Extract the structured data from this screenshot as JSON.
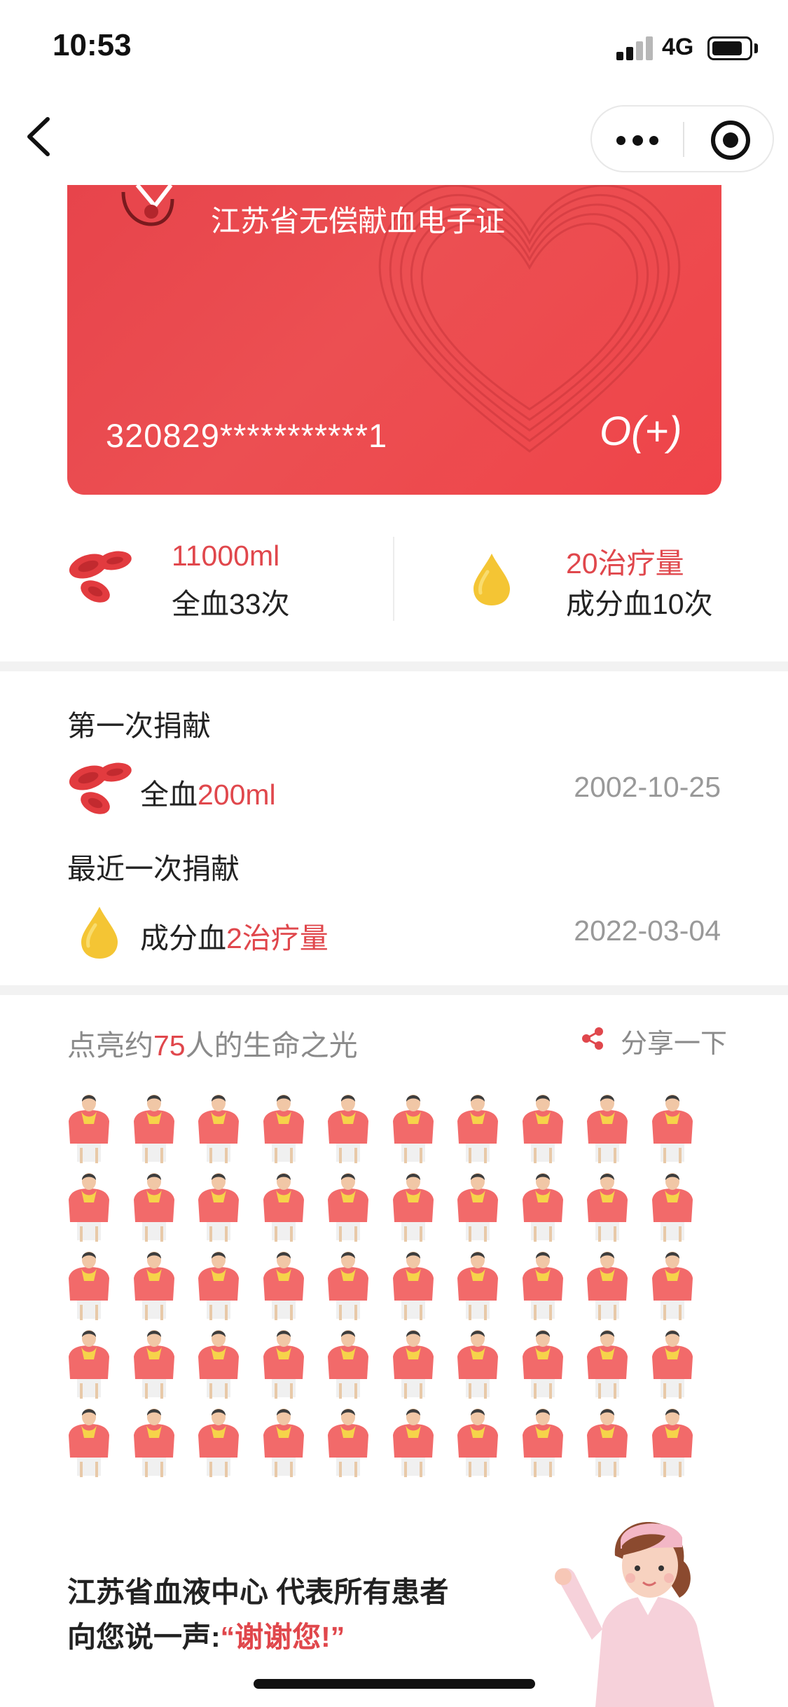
{
  "status_bar": {
    "time": "10:53",
    "network": "4G"
  },
  "nav": {
    "back_icon": "chevron-left-icon",
    "more_icon": "more-dots-icon",
    "target_icon": "target-icon"
  },
  "card": {
    "title": "江苏省无偿献血电子证",
    "id_number": "320829***********1",
    "blood_type": "O(+)",
    "colors": {
      "primary": "#ec4f52",
      "text": "#ffffff"
    }
  },
  "stats": {
    "whole_blood": {
      "amount": "11000ml",
      "count": "全血33次",
      "icon": "red-blood-cells-icon"
    },
    "component": {
      "amount": "20治疗量",
      "count": "成分血10次",
      "icon": "yellow-drop-icon"
    }
  },
  "records": {
    "first": {
      "label": "第一次捐献",
      "type": "全血",
      "value": "200ml",
      "date": "2002-10-25"
    },
    "latest": {
      "label": "最近一次捐献",
      "type": "成分血",
      "value": "2治疗量",
      "date": "2022-03-04"
    }
  },
  "lights": {
    "title_prefix": "点亮约",
    "count": "75",
    "title_suffix": "人的生命之光",
    "share_label": "分享一下",
    "people_shown": 50
  },
  "thanks": {
    "line1": "江苏省血液中心 代表所有患者",
    "line2_prefix": "向您说一声:",
    "line2_quote": "“谢谢您!”"
  },
  "colors": {
    "accent": "#e0474c",
    "muted": "#999999",
    "gap": "#f2f2f2"
  }
}
